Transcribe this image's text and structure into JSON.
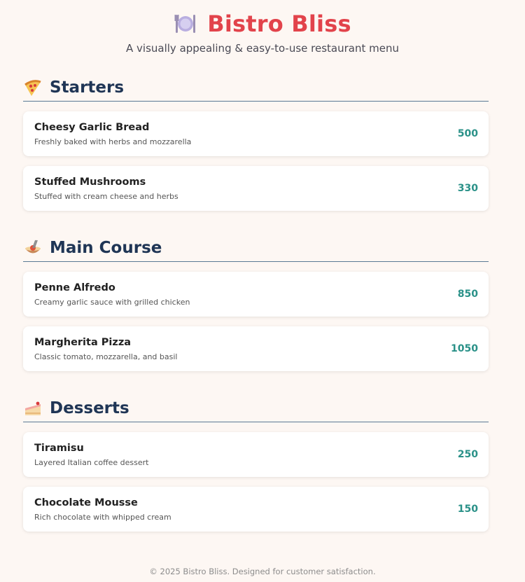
{
  "header": {
    "title": "Bistro Bliss",
    "subtitle": "A visually appealing & easy-to-use restaurant menu",
    "icon": "plate-cutlery-icon"
  },
  "colors": {
    "background": "#fdf7f3",
    "title": "#e2434b",
    "section_title": "#1f3555",
    "price": "#2a9188",
    "divider": "#5a7a95"
  },
  "sections": [
    {
      "title": "Starters",
      "icon": "pizza-icon",
      "items": [
        {
          "name": "Cheesy Garlic Bread",
          "description": "Freshly baked with herbs and mozzarella",
          "price": "500"
        },
        {
          "name": "Stuffed Mushrooms",
          "description": "Stuffed with cream cheese and herbs",
          "price": "330"
        }
      ]
    },
    {
      "title": "Main Course",
      "icon": "spaghetti-icon",
      "items": [
        {
          "name": "Penne Alfredo",
          "description": "Creamy garlic sauce with grilled chicken",
          "price": "850"
        },
        {
          "name": "Margherita Pizza",
          "description": "Classic tomato, mozzarella, and basil",
          "price": "1050"
        }
      ]
    },
    {
      "title": "Desserts",
      "icon": "cake-icon",
      "items": [
        {
          "name": "Tiramisu",
          "description": "Layered Italian coffee dessert",
          "price": "250"
        },
        {
          "name": "Chocolate Mousse",
          "description": "Rich chocolate with whipped cream",
          "price": "150"
        }
      ]
    }
  ],
  "footer": {
    "text": "© 2025 Bistro Bliss. Designed for customer satisfaction."
  }
}
